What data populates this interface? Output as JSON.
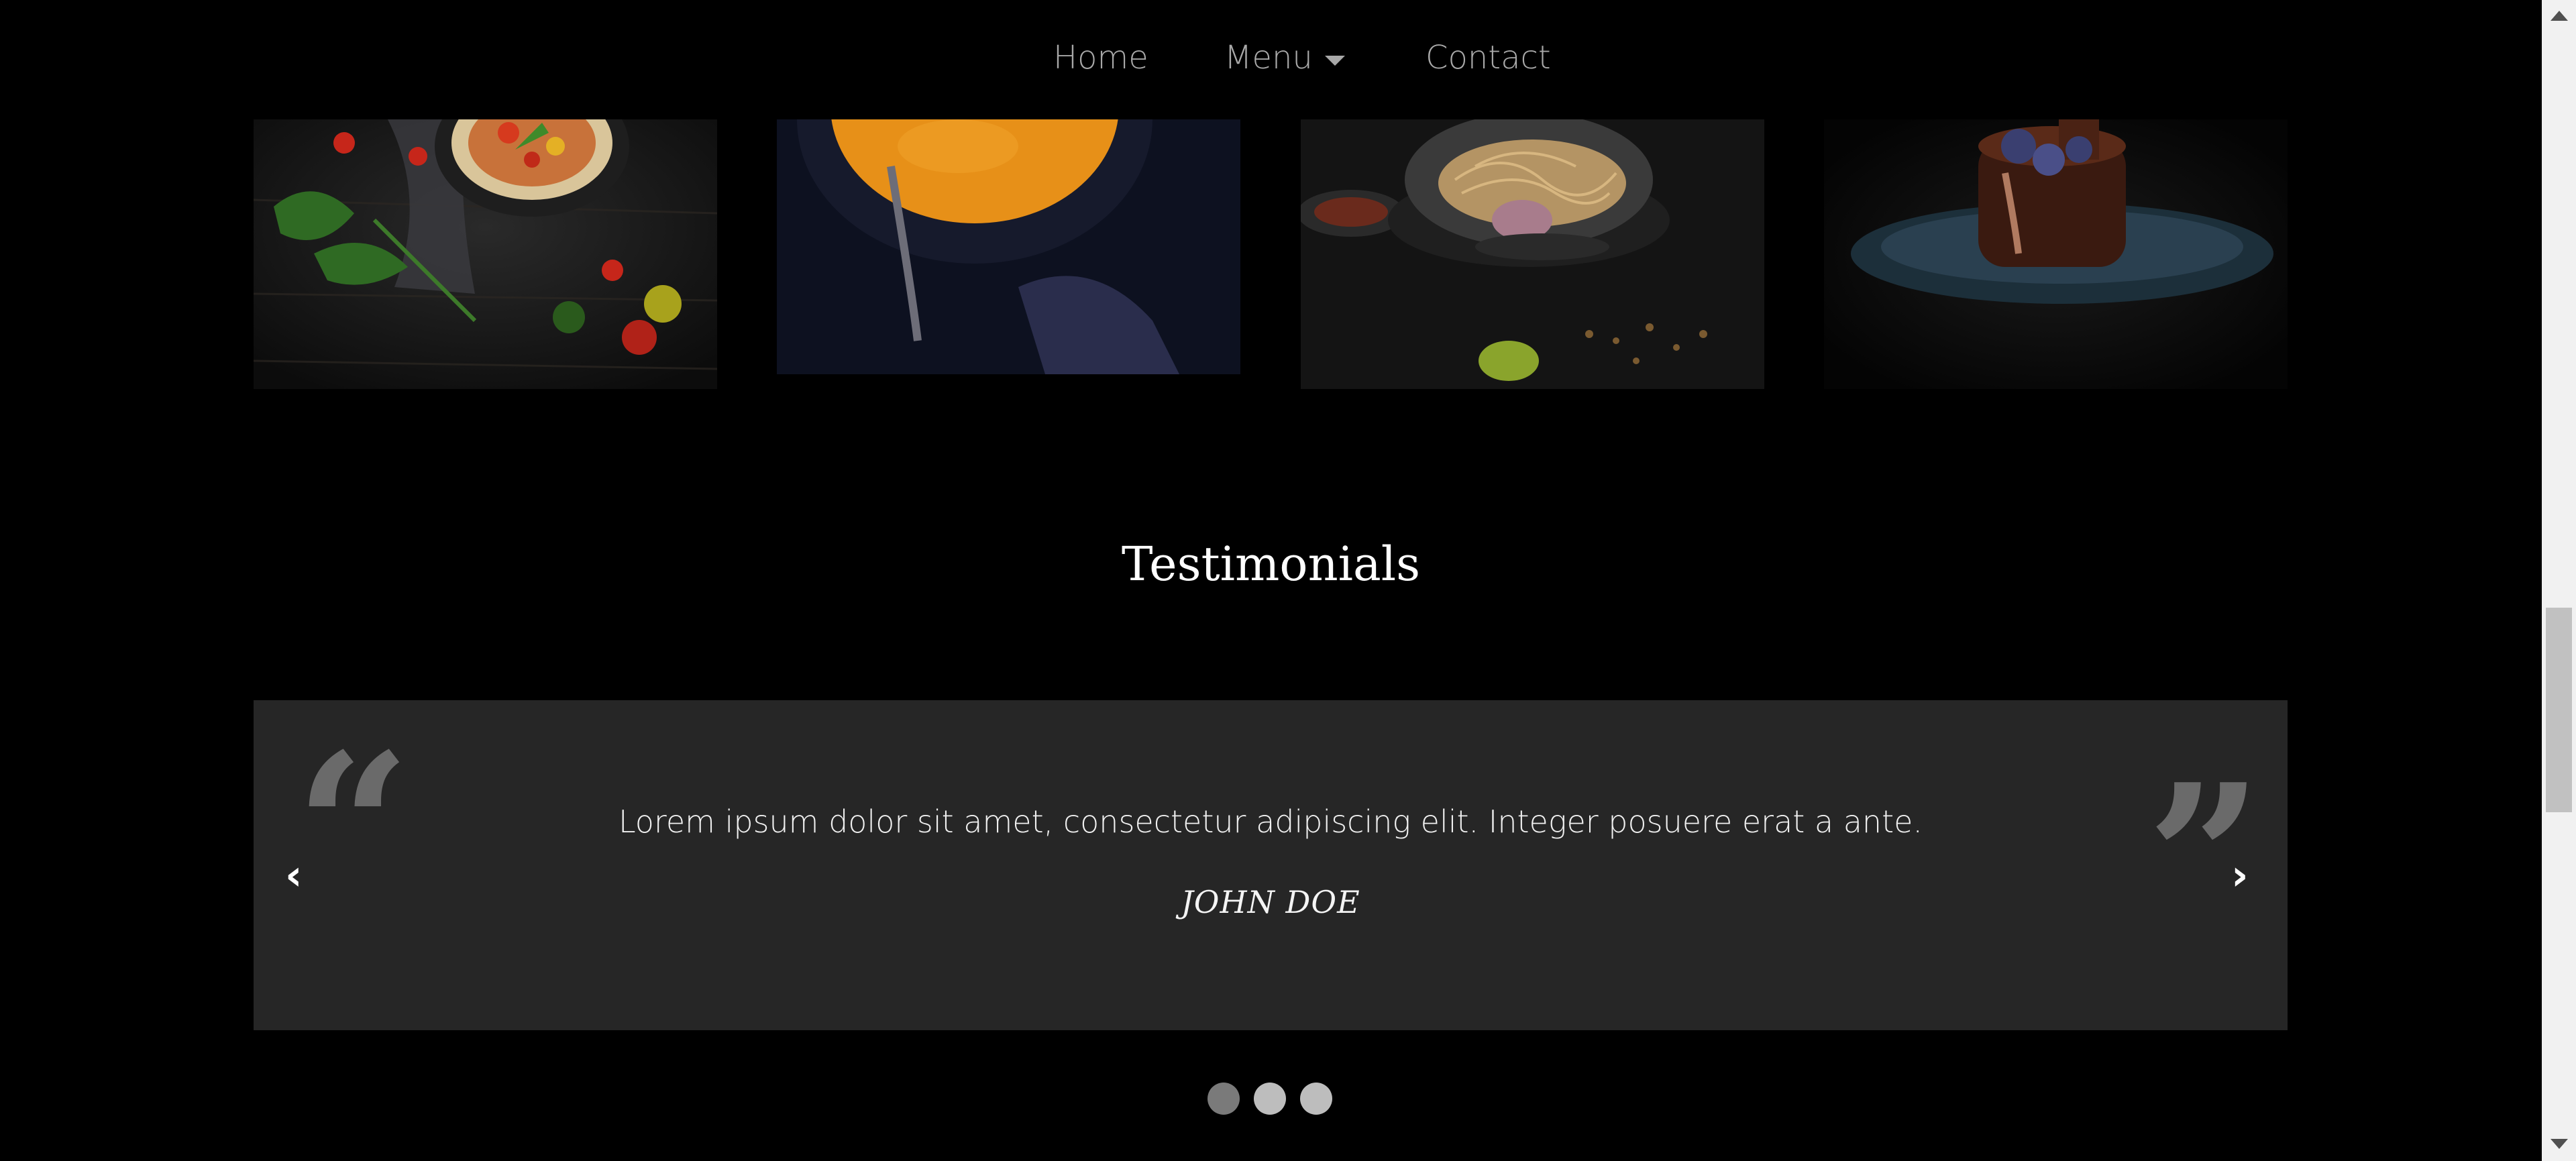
{
  "nav": {
    "home": "Home",
    "menu": "Menu",
    "contact": "Contact"
  },
  "gallery": {
    "items": [
      "pizza-photo",
      "soup-photo",
      "pasta-photo",
      "chocolate-cake-photo"
    ]
  },
  "testimonials": {
    "title": "Testimonials",
    "quote": "Lorem ipsum dolor sit amet, consectetur adipiscing elit. Integer posuere erat a ante.",
    "author": "JOHN DOE",
    "prev_arrow": "‹",
    "next_arrow": "›",
    "open_quote_glyph": "“",
    "close_quote_glyph": "”",
    "active_slide": 1,
    "slide_count": 3
  },
  "colors": {
    "background": "#000000",
    "card": "#262626",
    "nav_text": "#a8a8a8",
    "quote_mark": "#6a6a6a",
    "dot_active": "#7a7a7a",
    "dot_inactive": "#bdbdbd"
  }
}
